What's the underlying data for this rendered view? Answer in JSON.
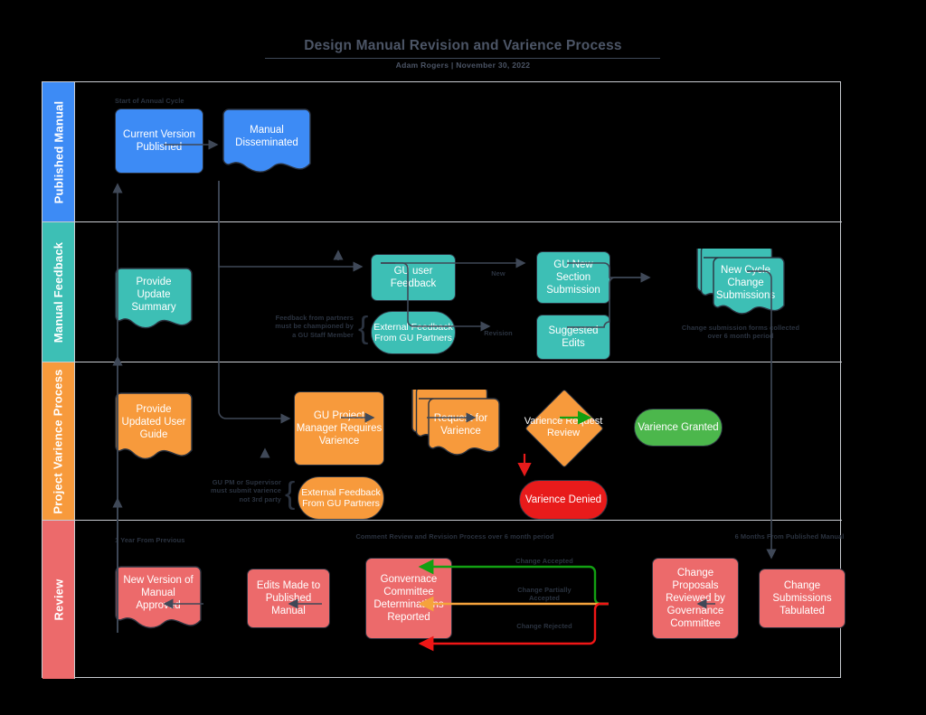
{
  "header": {
    "title": "Design Manual Revision and Varience Process",
    "subtitle": "Adam Rogers  |  November 30, 2022"
  },
  "colors": {
    "blue": "#3d8bf5",
    "teal": "#3dbfb5",
    "orange": "#f79a3c",
    "red": "#ec6a6b",
    "green": "#4cb74c",
    "denied_red": "#e81b1b",
    "stroke": "#2b3340",
    "lane_border": "#c9ccd1",
    "text_dark": "#2b3340",
    "arrow_accepted": "#12a012",
    "arrow_partial": "#f5a33c",
    "arrow_rejected": "#f01616"
  },
  "lanes": [
    {
      "id": "published-manual",
      "label": "Published Manual",
      "color": "#3d8bf5"
    },
    {
      "id": "manual-feedback",
      "label": "Manual Feedback",
      "color": "#3dbfb5"
    },
    {
      "id": "project-variance-process",
      "label": "Project Varience Process",
      "color": "#f79a3c"
    },
    {
      "id": "review",
      "label": "Review",
      "color": "#ec6a6b"
    }
  ],
  "nodes": {
    "current_version_published": "Current Version Published",
    "manual_disseminated": "Manual Disseminated",
    "provide_update_summary": "Provide Update Summary",
    "gu_user_feedback": "GU user Feedback",
    "external_feedback_feedback_lane": "External Feedback From GU Partners",
    "gu_new_section_submission": "GU New Section Submission",
    "suggested_edits": "Suggested Edits",
    "new_cycle_change_submissions": "New Cycle Change Submissions",
    "provide_updated_user_guide": "Provide Updated User Guide",
    "gu_project_manager_requires_variance": "GU Project Manager Requires Varience",
    "external_feedback_variance_lane": "External Feedback From GU Partners",
    "request_for_variance": "Request for Varience",
    "variance_request_review": "Varience Request Review",
    "variance_granted": "Varience Granted",
    "variance_denied": "Varience Denied",
    "new_version_of_manual_approved": "New Version of Manual Approved",
    "edits_made_to_published_manual": "Edits Made to Published Manual",
    "governance_committee_determinations_reported": "Gonvernace Committee Determinations Reported",
    "change_proposals_reviewed": "Change Proposals Reviewed by Governance Committee",
    "change_submissions_tabulated": "Change Submissions Tabulated"
  },
  "edge_labels": {
    "new": "New",
    "revision": "Revision",
    "change_accepted": "Change Accepted",
    "change_partially_accepted": "Change Partially Accepted",
    "change_rejected": "Change Rejected"
  },
  "annotations": {
    "start_of_annual_cycle": "Start of Annual Cycle",
    "feedback_champion": "Feedback from partners must be championed  by a GU Staff Member",
    "change_forms_collected": "Change submission forms collected over 6 month period",
    "variance_submitter": "GU PM or Supervisor must submit varience not 3rd party",
    "one_year_from_previous": "1 Year From Previous",
    "comment_review_process": "Comment Review and Revision Process over 6 month period",
    "six_months_from_published": "6 Months From Published Manual"
  }
}
